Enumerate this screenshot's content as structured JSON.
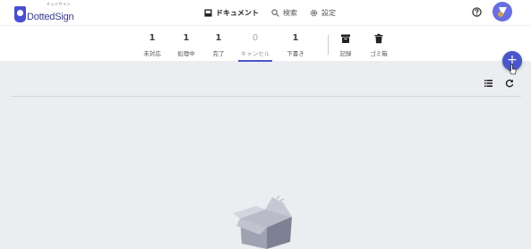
{
  "app": {
    "logo_text": "DottedSign",
    "logo_subtext": "ドットサイン"
  },
  "topnav": {
    "items": [
      {
        "label": "ドキュメント",
        "icon": "inbox-tray-icon",
        "active": true
      },
      {
        "label": "検索",
        "icon": "search-icon",
        "active": false
      },
      {
        "label": "設定",
        "icon": "gear-icon",
        "active": false
      }
    ]
  },
  "header_icons": [
    "help-circle-icon",
    "avatar"
  ],
  "tabs": [
    {
      "count": "1",
      "label": "未対応"
    },
    {
      "count": "1",
      "label": "処理中"
    },
    {
      "count": "1",
      "label": "完了"
    },
    {
      "count": "0",
      "label": "キャンセル",
      "selected": true
    },
    {
      "count": "1",
      "label": "下書き"
    }
  ],
  "archive_tabs": [
    {
      "label": "記録",
      "icon": "archive-box-icon"
    },
    {
      "label": "ゴミ箱",
      "icon": "trash-icon"
    }
  ],
  "fab": {
    "label": "+"
  },
  "colors": {
    "accent": "#4a55c8",
    "background": "#ecedf0",
    "avatar": "#6a6ee0"
  }
}
